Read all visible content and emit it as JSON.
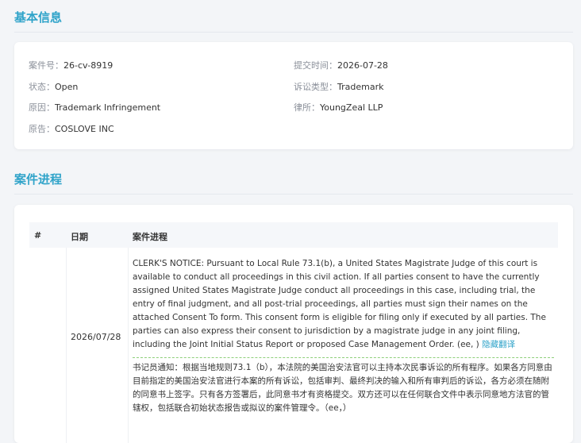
{
  "basic_info": {
    "title": "基本信息",
    "fields": [
      {
        "label": "案件号：",
        "value": "26-cv-8919"
      },
      {
        "label": "提交时间：",
        "value": "2026-07-28"
      },
      {
        "label": "状态：",
        "value": "Open"
      },
      {
        "label": "诉讼类型：",
        "value": "Trademark"
      },
      {
        "label": "原因：",
        "value": "Trademark Infringement"
      },
      {
        "label": "律所：",
        "value": "YoungZeal LLP"
      },
      {
        "label": "原告：",
        "value": "COSLOVE INC"
      }
    ]
  },
  "progress": {
    "title": "案件进程",
    "headers": {
      "num": "#",
      "date": "日期",
      "progress": "案件进程"
    },
    "rows": [
      {
        "num": "",
        "date": "2026/07/28",
        "text_en": "CLERK'S NOTICE: Pursuant to Local Rule 73.1(b), a United States Magistrate Judge of this court is available to conduct all proceedings in this civil action. If all parties consent to have the currently assigned United States Magistrate Judge conduct all proceedings in this case, including trial, the entry of final judgment, and all post-trial proceedings, all parties must sign their names on the attached Consent To form. This consent form is eligible for filing only if executed by all parties. The parties can also express their consent to jurisdiction by a magistrate judge in any joint filing, including the Joint Initial Status Report or proposed Case Management Order. (ee, )",
        "toggle_label": "隐藏翻译",
        "text_zh": "书记员通知：根据当地规则73.1（b），本法院的美国治安法官可以主持本次民事诉讼的所有程序。如果各方同意由目前指定的美国治安法官进行本案的所有诉讼，包括审判、最终判决的输入和所有审判后的诉讼，各方必须在随附的同意书上签字。只有各方签署后，此同意书才有资格提交。双方还可以在任何联合文件中表示同意地方法官的管辖权，包括联合初始状态报告或拟议的案件管理令。（ee，）"
      }
    ]
  }
}
